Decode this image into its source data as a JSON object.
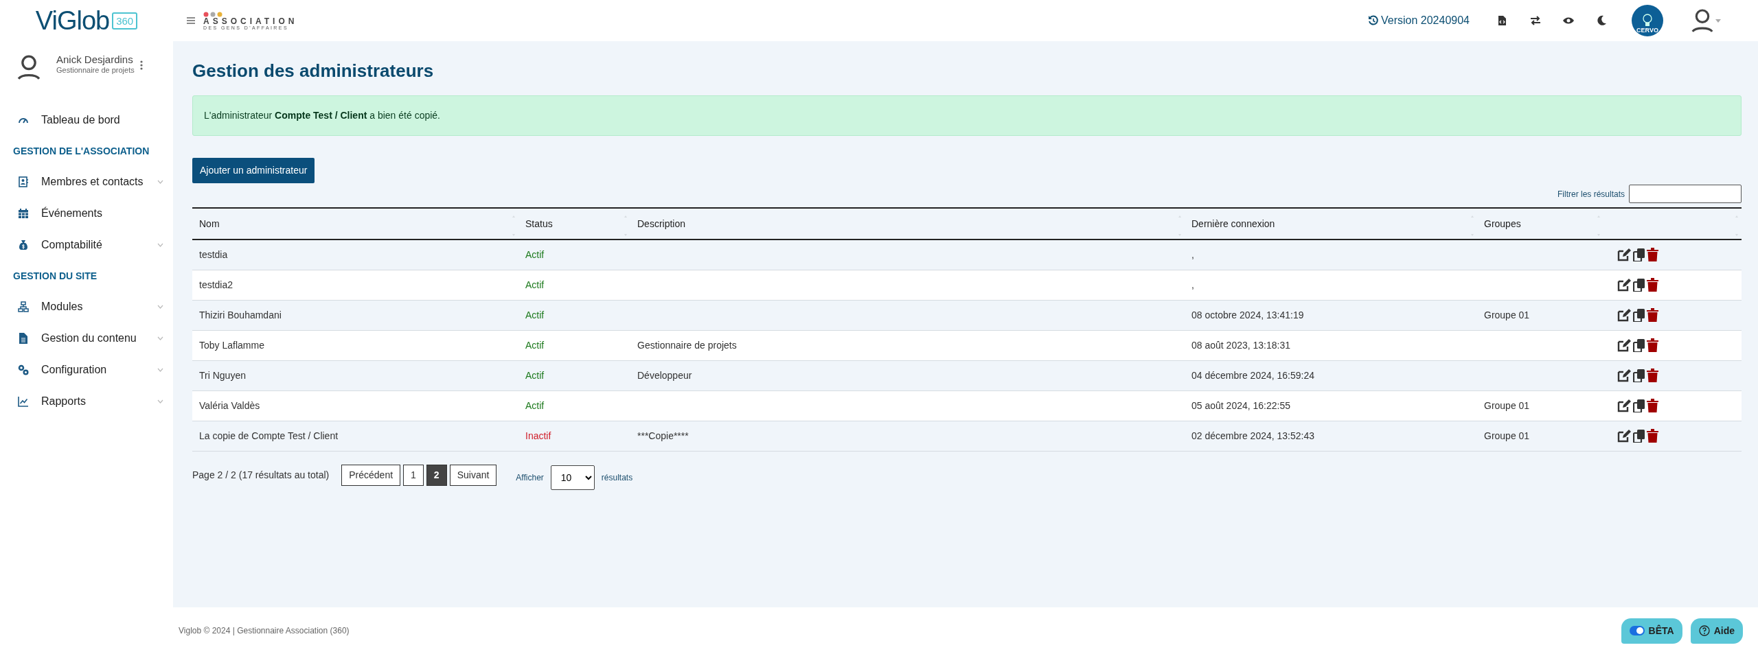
{
  "header": {
    "logo_text": "ViGlob",
    "logo_badge": "360",
    "association_name": "ASSOCIATION",
    "association_sub": "DES GENS D'AFFAIRES",
    "version": "Version 20240904",
    "partner_badge": "CERVO"
  },
  "user": {
    "name": "Anick Desjardins",
    "role": "Gestionnaire de projets"
  },
  "sidebar": {
    "items": [
      {
        "kind": "link",
        "label": "Tableau de bord",
        "expandable": false
      },
      {
        "kind": "heading",
        "label": "GESTION DE L'ASSOCIATION"
      },
      {
        "kind": "link",
        "label": "Membres et contacts",
        "expandable": true
      },
      {
        "kind": "link",
        "label": "Événements",
        "expandable": false
      },
      {
        "kind": "link",
        "label": "Comptabilité",
        "expandable": true
      },
      {
        "kind": "heading",
        "label": "GESTION DU SITE"
      },
      {
        "kind": "link",
        "label": "Modules",
        "expandable": true
      },
      {
        "kind": "link",
        "label": "Gestion du contenu",
        "expandable": true
      },
      {
        "kind": "link",
        "label": "Configuration",
        "expandable": true
      },
      {
        "kind": "link",
        "label": "Rapports",
        "expandable": true
      }
    ]
  },
  "page": {
    "title": "Gestion des administrateurs",
    "alert": "L'administrateur **Compte Test / Client** a bien été copié.",
    "add_button": "Ajouter un administrateur",
    "filter_label": "Filtrer les résultats"
  },
  "table": {
    "columns": [
      "Nom",
      "Status",
      "Description",
      "Dernière connexion",
      "Groupes"
    ],
    "rows": [
      {
        "name": "testdia",
        "status": "Actif",
        "active": true,
        "description": "",
        "last_login": ",",
        "groups": ""
      },
      {
        "name": "testdia2",
        "status": "Actif",
        "active": true,
        "description": "",
        "last_login": ",",
        "groups": ""
      },
      {
        "name": "Thiziri Bouhamdani",
        "status": "Actif",
        "active": true,
        "description": "",
        "last_login": "08 octobre 2024, 13:41:19",
        "groups": "Groupe 01"
      },
      {
        "name": "Toby Laflamme",
        "status": "Actif",
        "active": true,
        "description": "Gestionnaire de projets",
        "last_login": "08 août 2023, 13:18:31",
        "groups": ""
      },
      {
        "name": "Tri Nguyen",
        "status": "Actif",
        "active": true,
        "description": "Développeur",
        "last_login": "04 décembre 2024, 16:59:24",
        "groups": ""
      },
      {
        "name": "Valéria Valdès",
        "status": "Actif",
        "active": true,
        "description": "",
        "last_login": "05 août 2024, 16:22:55",
        "groups": "Groupe 01"
      },
      {
        "name": "La copie de Compte Test / Client",
        "status": "Inactif",
        "active": false,
        "description": "***Copie****",
        "last_login": "02 décembre 2024, 13:52:43",
        "groups": "Groupe 01"
      }
    ]
  },
  "pagination": {
    "summary": "Page 2 / 2 (17 résultats au total)",
    "previous": "Précédent",
    "next": "Suivant",
    "pages": [
      {
        "label": "1",
        "selected": false
      },
      {
        "label": "2",
        "selected": true
      }
    ],
    "show_label": "Afficher",
    "page_size": "10",
    "results_label": "résultats"
  },
  "footer": {
    "text": "Viglob © 2024 | Gestionnaire Association (360)",
    "beta": {
      "label": "BÊTA",
      "on": true
    },
    "help": "Aide"
  }
}
